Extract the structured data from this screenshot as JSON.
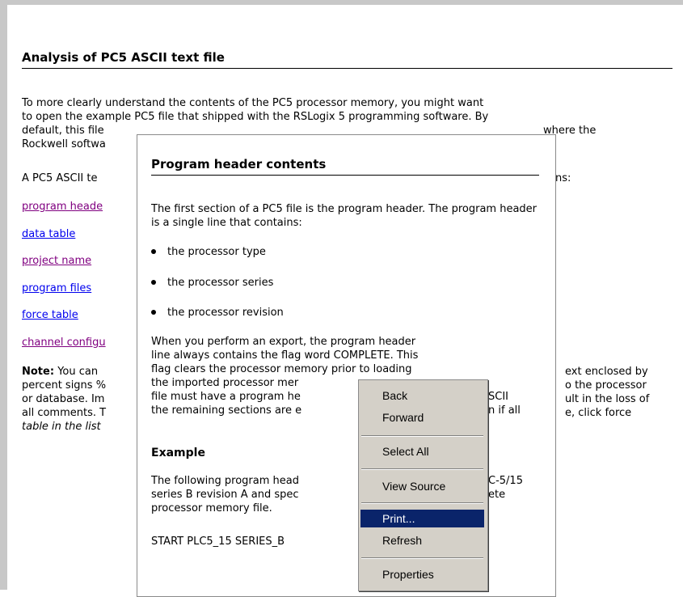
{
  "page": {
    "title": "Analysis of PC5 ASCII text file",
    "p1_lines": [
      "To more clearly understand the contents of the PC5 processor memory, you might want",
      "to open the example PC5 file that shipped with the RSLogix 5 programming software. By",
      "default, this file",
      "Rockwell softwa"
    ],
    "p1_tail": "where the",
    "p2_left": "A PC5 ASCII te",
    "p2_right": "ns:",
    "toc": [
      {
        "label": "program heade",
        "visited": true
      },
      {
        "label": "data table",
        "visited": false
      },
      {
        "label": "project name",
        "visited": true
      },
      {
        "label": "program files",
        "visited": false
      },
      {
        "label": "force table",
        "visited": false
      },
      {
        "label": "channel configu",
        "visited": true
      }
    ],
    "note_label": "Note:",
    "note_lines_left": [
      "You can",
      "percent signs %",
      "or database. Im",
      "all comments. T",
      "table in the list"
    ],
    "note_lines_right": [
      "ext enclosed by",
      "o the processor",
      "ult in the loss of",
      "e, click force"
    ]
  },
  "popup": {
    "title": "Program header contents",
    "intro": "The first section of a PC5 file is the program header. The program header is a single line that contains:",
    "bullets": [
      "the processor type",
      "the processor series",
      "the processor revision"
    ],
    "export_lines": [
      "When you perform an export, the program header",
      "line always contains the flag word COMPLETE. This",
      "flag clears the processor memory prior to loading",
      "the imported processor mer",
      "file must have a program he",
      "the remaining sections are e"
    ],
    "export_right": [
      "SCII",
      "n if all"
    ],
    "example_heading": "Example",
    "example_lines": [
      "The following program head",
      "series B revision A and spec",
      "processor memory file."
    ],
    "example_right": [
      "C-5/15",
      "ete"
    ],
    "code_line": "START PLC5_15 SERIES_B"
  },
  "context_menu": {
    "items": [
      "Back",
      "Forward",
      "Select All",
      "View Source",
      "Print...",
      "Refresh",
      "Properties"
    ],
    "selected": "Print..."
  }
}
